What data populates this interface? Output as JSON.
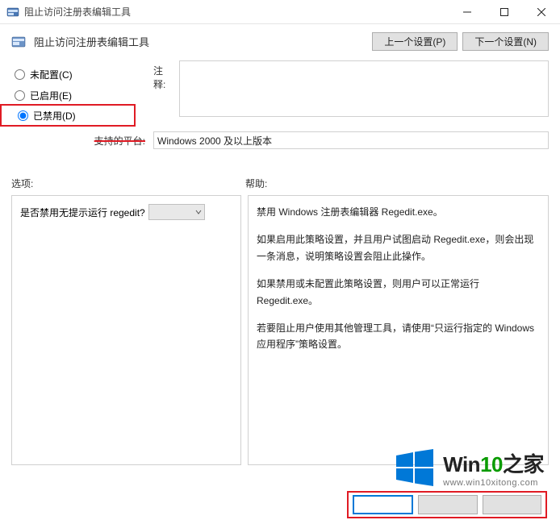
{
  "title": "阻止访问注册表编辑工具",
  "header": {
    "title": "阻止访问注册表编辑工具",
    "prev_btn": "上一个设置(P)",
    "next_btn": "下一个设置(N)"
  },
  "radios": {
    "not_configured": "未配置(C)",
    "enabled": "已启用(E)",
    "disabled": "已禁用(D)"
  },
  "labels": {
    "comment": "注释:",
    "supported_on": "支持的平台:",
    "options": "选项:",
    "help": "帮助:"
  },
  "fields": {
    "comment_value": "",
    "supported_on_value": "Windows 2000 及以上版本"
  },
  "options_panel": {
    "question": "是否禁用无提示运行 regedit?"
  },
  "help_paragraphs": [
    "禁用 Windows 注册表编辑器 Regedit.exe。",
    "如果启用此策略设置，并且用户试图启动 Regedit.exe，则会出现一条消息，说明策略设置会阻止此操作。",
    "如果禁用或未配置此策略设置，则用户可以正常运行 Regedit.exe。",
    "若要阻止用户使用其他管理工具，请使用“只运行指定的 Windows 应用程序”策略设置。"
  ],
  "watermark": {
    "brand_win": "Win",
    "brand_10": "10",
    "brand_suffix": "之家",
    "url": "www.win10xitong.com"
  }
}
